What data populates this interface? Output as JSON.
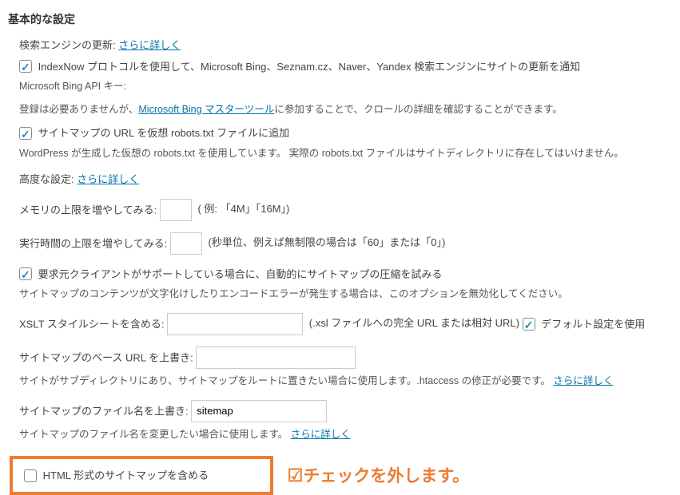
{
  "section_title": "基本的な設定",
  "search_engine": {
    "label": "検索エンジンの更新:",
    "more_link": "さらに詳しく"
  },
  "indexnow": {
    "label": "IndexNow プロトコルを使用して、Microsoft Bing、Seznam.cz、Naver、Yandex 検索エンジンにサイトの更新を通知",
    "api_label": "Microsoft Bing API キー:",
    "desc_before_link": "登録は必要ありませんが、",
    "desc_link": "Microsoft Bing マスターツール",
    "desc_after_link": "に参加することで、クロールの詳細を確認することができます。"
  },
  "robots": {
    "label": "サイトマップの URL を仮想 robots.txt ファイルに追加",
    "desc": "WordPress が生成した仮想の robots.txt を使用しています。 実際の robots.txt ファイルはサイトディレクトリに存在してはいけません。"
  },
  "advanced": {
    "label": "高度な設定:",
    "more_link": "さらに詳しく"
  },
  "memory": {
    "label": "メモリの上限を増やしてみる:",
    "hint": "( 例: 「4M」「16M」)",
    "value": ""
  },
  "exec_time": {
    "label": "実行時間の上限を増やしてみる:",
    "hint": "(秒単位、例えば無制限の場合は「60」または「0」)",
    "value": ""
  },
  "compression": {
    "label": "要求元クライアントがサポートしている場合に、自動的にサイトマップの圧縮を試みる",
    "desc": "サイトマップのコンテンツが文字化けしたりエンコードエラーが発生する場合は、このオプションを無効化してください。"
  },
  "xslt": {
    "label": "XSLT スタイルシートを含める:",
    "value": "",
    "hint": "(.xsl ファイルへの完全 URL または相対 URL)",
    "default_label": "デフォルト設定を使用"
  },
  "base_url": {
    "label": "サイトマップのベース URL を上書き:",
    "value": "",
    "desc_before": "サイトがサブディレクトリにあり、サイトマップをルートに置きたい場合に使用します。.htaccess の修正が必要です。 ",
    "desc_link": "さらに詳しく"
  },
  "filename": {
    "label": "サイトマップのファイル名を上書き:",
    "value": "sitemap",
    "desc_before": "サイトマップのファイル名を変更したい場合に使用します。 ",
    "desc_link": "さらに詳しく"
  },
  "html_sitemap": {
    "label": "HTML 形式のサイトマップを含める"
  },
  "annotation": {
    "symbol": "☑",
    "text": "チェックを外します。"
  }
}
